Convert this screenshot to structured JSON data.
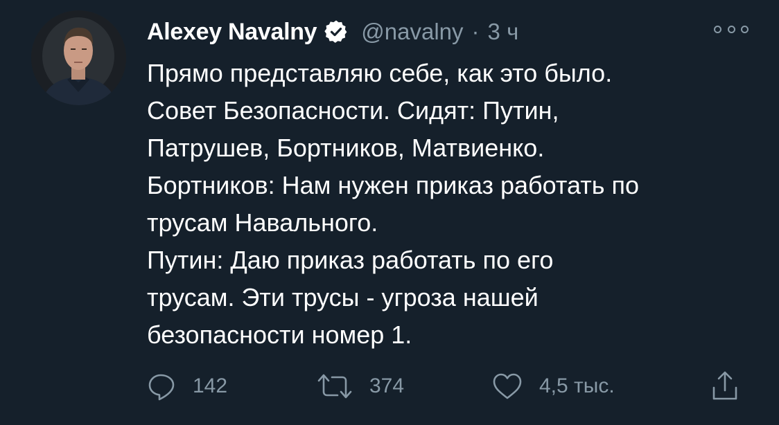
{
  "tweet": {
    "author_name": "Alexey Navalny",
    "handle": "@navalny",
    "separator": "·",
    "time": "3 ч",
    "lines": [
      "Прямо представляю себе, как это было.",
      "Совет Безопасности. Сидят: Путин,",
      "Патрушев, Бортников, Матвиенко.",
      "Бортников: Нам нужен приказ работать по",
      "трусам Навального.",
      "Путин: Даю приказ работать по его",
      "трусам. Эти трусы - угроза нашей",
      "безопасности номер 1."
    ]
  },
  "actions": {
    "reply_count": "142",
    "retweet_count": "374",
    "like_count": "4,5 тыс."
  },
  "icons": {
    "verified": "verified-badge-icon",
    "more": "more-options-icon",
    "reply": "reply-icon",
    "retweet": "retweet-icon",
    "like": "heart-icon",
    "share": "share-icon"
  },
  "colors": {
    "background": "#15202b",
    "primary_text": "#ffffff",
    "secondary_text": "#8899a6"
  }
}
